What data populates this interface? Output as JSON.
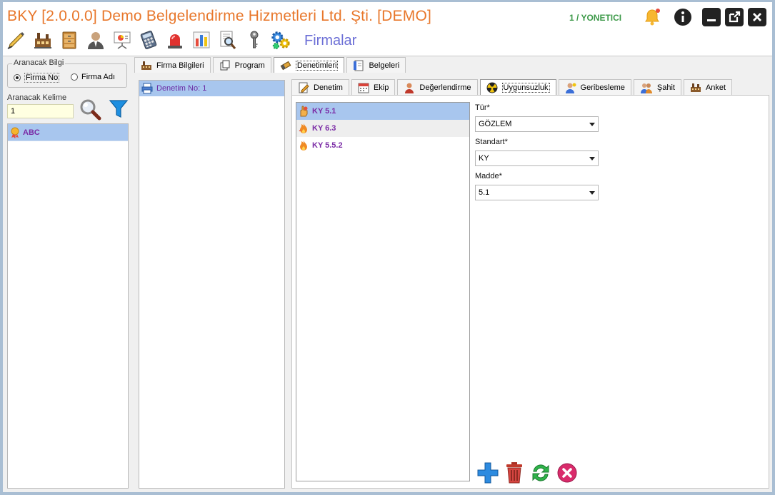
{
  "window": {
    "title": "BKY [2.0.0.0] Demo Belgelendirme Hizmetleri Ltd. Şti. [DEMO]",
    "user": "1 / YONETICI",
    "section": "Firmalar"
  },
  "toolbar": {
    "icons": [
      "pen-icon",
      "factory-icon",
      "cabinet-icon",
      "user-icon",
      "presentation-icon",
      "calculator-icon",
      "alarm-icon",
      "chart-icon",
      "magnifier-report-icon",
      "key-icon",
      "gears-icon"
    ]
  },
  "search": {
    "group_label": "Aranacak Bilgi",
    "option_firma_no": "Firma No",
    "option_firma_adi": "Firma Adı",
    "keyword_label": "Aranacak Kelime",
    "keyword_value": "1"
  },
  "firms": [
    {
      "name": "ABC"
    }
  ],
  "main_tabs": [
    {
      "label": "Firma Bilgileri"
    },
    {
      "label": "Program"
    },
    {
      "label": "Denetimleri"
    },
    {
      "label": "Belgeleri"
    }
  ],
  "audits": [
    {
      "label": "Denetim No: 1"
    }
  ],
  "sub_tabs": [
    {
      "label": "Denetim"
    },
    {
      "label": "Ekip"
    },
    {
      "label": "Değerlendirme"
    },
    {
      "label": "Uygunsuzluk"
    },
    {
      "label": "Geribesleme"
    },
    {
      "label": "Şahit"
    },
    {
      "label": "Anket"
    }
  ],
  "clauses": [
    {
      "code": "KY  5.1"
    },
    {
      "code": "KY  6.3"
    },
    {
      "code": "KY  5.5.2"
    }
  ],
  "form": {
    "tur_label": "Tür*",
    "tur_value": "GÖZLEM",
    "standart_label": "Standart*",
    "standart_value": "KY",
    "madde_label": "Madde*",
    "madde_value": "5.1"
  },
  "colors": {
    "title": "#e8772b",
    "user": "#3e9a4a",
    "section": "#6c6fd6",
    "selection": "#a8c6ee",
    "item_text": "#7a2aa5"
  }
}
